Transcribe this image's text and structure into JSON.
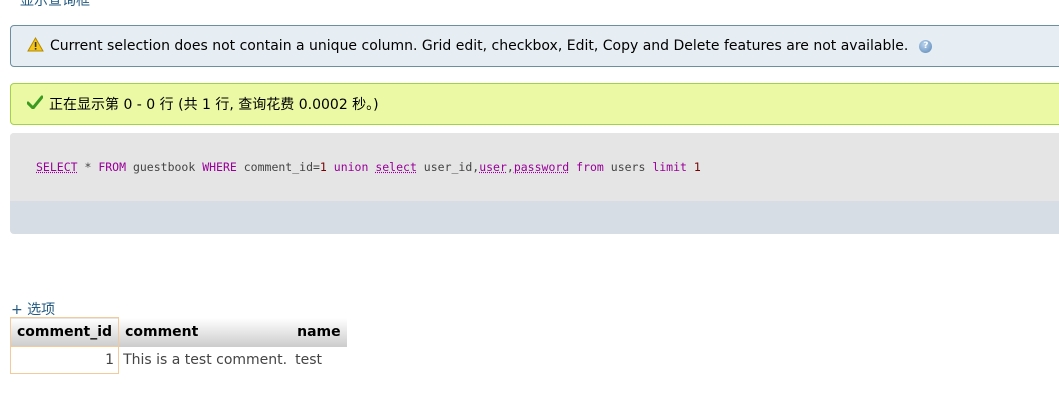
{
  "top_link": "显示查询框",
  "warning": {
    "icon": "warning-icon",
    "text": "Current selection does not contain a unique column. Grid edit, checkbox, Edit, Copy and Delete features are not available.",
    "help_icon_glyph": "?"
  },
  "success": {
    "icon": "checkmark-icon",
    "text": "正在显示第 0 - 0 行 (共 1 行, 查询花费 0.0002 秒。)"
  },
  "sql": {
    "select": "SELECT",
    "star": " * ",
    "from": "FROM",
    "table": " guestbook ",
    "where": "WHERE",
    "cond": " comment_id=",
    "cond_val": "1",
    "union": " union ",
    "select2": "select",
    "col1": " user_id,",
    "col2": "user",
    "comma": ",",
    "col3": "password",
    "from2": " from",
    "table2": " users ",
    "limit": "limit",
    "limit_val": " 1"
  },
  "options_link": "+ 选项",
  "table": {
    "headers": [
      "comment_id",
      "comment",
      "name"
    ],
    "rows": [
      [
        "1",
        "This is a test comment.",
        "test"
      ]
    ]
  }
}
